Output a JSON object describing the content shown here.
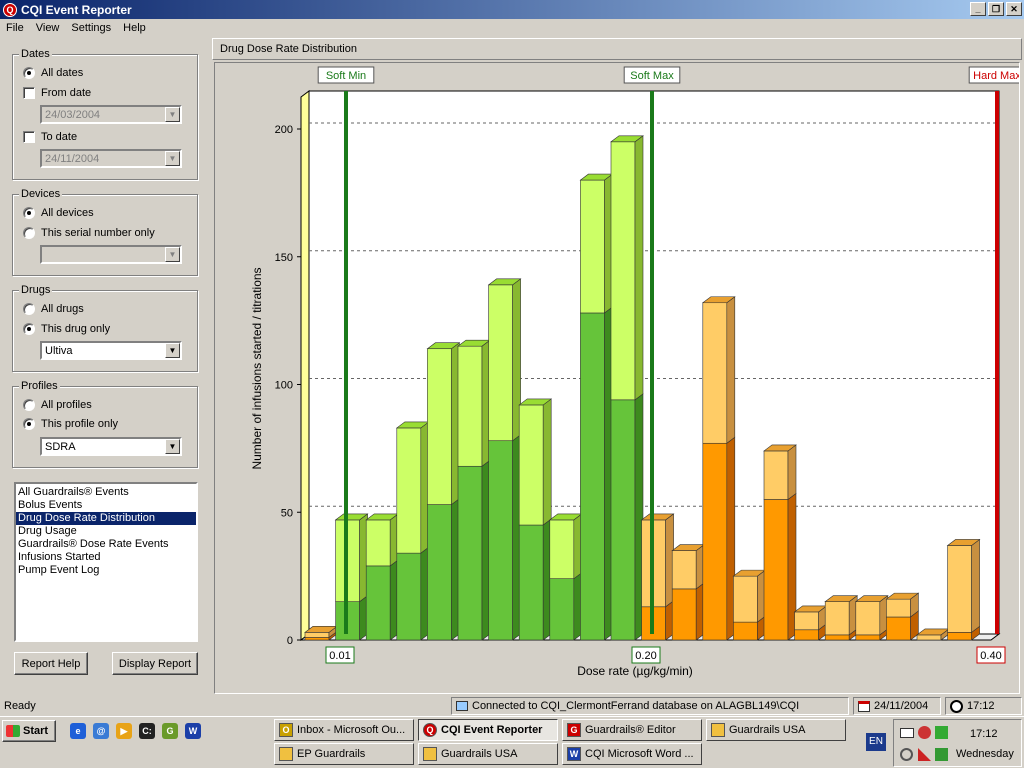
{
  "window": {
    "title": "CQI Event Reporter",
    "icon": "app-logo-icon"
  },
  "menu": [
    "File",
    "View",
    "Settings",
    "Help"
  ],
  "filters": {
    "dates": {
      "legend": "Dates",
      "all": "All dates",
      "from_label": "From date",
      "from_value": "24/03/2004",
      "to_label": "To date",
      "to_value": "24/11/2004"
    },
    "devices": {
      "legend": "Devices",
      "all": "All devices",
      "serial": "This serial number only",
      "serial_value": ""
    },
    "drugs": {
      "legend": "Drugs",
      "all": "All drugs",
      "this": "This drug only",
      "value": "Ultiva"
    },
    "profiles": {
      "legend": "Profiles",
      "all": "All profiles",
      "this": "This profile only",
      "value": "SDRA"
    }
  },
  "reports": [
    "All Guardrails® Events",
    "Bolus Events",
    "Drug Dose Rate Distribution",
    "Drug Usage",
    "Guardrails® Dose Rate Events",
    "Infusions Started",
    "Pump Event Log"
  ],
  "selected_report": "Drug Dose Rate Distribution",
  "buttons": {
    "help": "Report Help",
    "display": "Display Report"
  },
  "panel_title": "Drug Dose Rate Distribution",
  "chart_data": {
    "type": "bar",
    "stacked": true,
    "ylabel": "Number of infusions started / titrations",
    "xlabel": "Dose rate (µg/kg/min)",
    "ylim": [
      0,
      210
    ],
    "yticks": [
      0,
      50,
      100,
      150,
      200
    ],
    "grid": true,
    "limits": [
      {
        "label": "Soft Min",
        "value": "0.01",
        "color": "#1a7a1a"
      },
      {
        "label": "Soft Max",
        "value": "0.20",
        "color": "#1a7a1a"
      },
      {
        "label": "Hard Max",
        "value": "0.40",
        "color": "#cc0000"
      }
    ],
    "series": [
      {
        "name": "started",
        "values": [
          1,
          15,
          29,
          34,
          53,
          68,
          78,
          45,
          24,
          128,
          94,
          13,
          20,
          77,
          7,
          55,
          4,
          2,
          2,
          9,
          0,
          3
        ]
      },
      {
        "name": "titrations",
        "values": [
          2,
          32,
          18,
          49,
          61,
          47,
          61,
          47,
          23,
          52,
          101,
          34,
          15,
          55,
          18,
          19,
          7,
          13,
          13,
          7,
          2,
          34
        ]
      }
    ],
    "colors": {
      "in_range_dark": "#66c43a",
      "in_range_light": "#ccff66",
      "above_dark": "#ff9900",
      "above_light": "#ffcc66"
    }
  },
  "status": {
    "ready": "Ready",
    "connection": "Connected to CQI_ClermontFerrand database on ALAGBL149\\CQI",
    "date": "24/11/2004",
    "time": "17:12"
  },
  "taskbar": {
    "start": "Start",
    "tasks_top": [
      "Inbox - Microsoft Ou...",
      "CQI Event Reporter",
      "Guardrails® Editor",
      "Guardrails USA"
    ],
    "tasks_bottom": [
      "EP Guardrails",
      "Guardrails USA",
      "CQI Microsoft Word ..."
    ],
    "lang": "EN",
    "clock": "17:12",
    "day": "Wednesday"
  }
}
